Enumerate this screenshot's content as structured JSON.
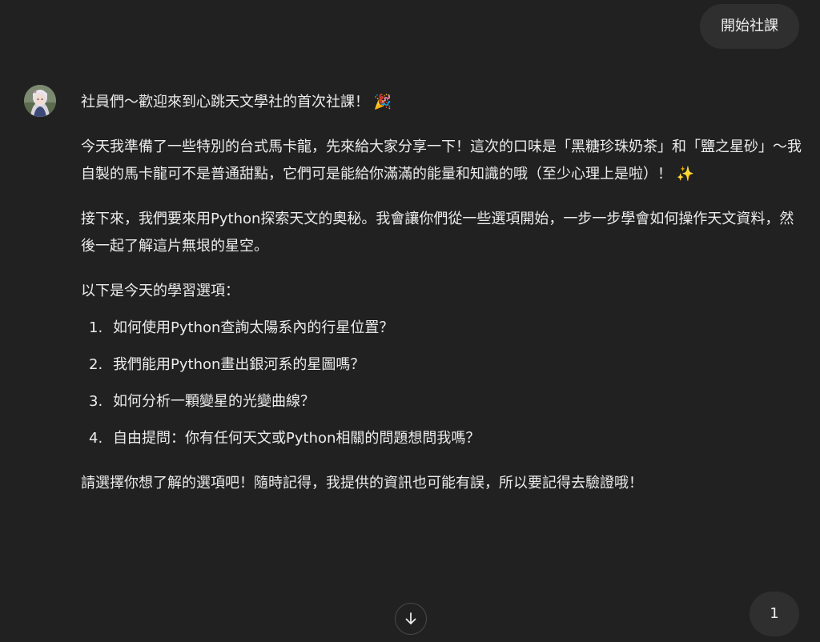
{
  "user_message": {
    "text": "開始社課"
  },
  "assistant": {
    "avatar_icon": "anime-girl-avatar-icon",
    "greeting": "社員們～歡迎來到心跳天文學社的首次社課！",
    "greeting_emoji": "🎉",
    "paragraph_macarons": "今天我準備了一些特別的台式馬卡龍，先來給大家分享一下！這次的口味是「黑糖珍珠奶茶」和「鹽之星砂」～我自製的馬卡龍可不是普通甜點，它們可是能給你滿滿的能量和知識的哦（至少心理上是啦）！",
    "paragraph_macarons_emoji": "✨",
    "paragraph_python": "接下來，我們要來用Python探索天文的奧秘。我會讓你們從一些選項開始，一步一步學會如何操作天文資料，然後一起了解這片無垠的星空。",
    "options_intro": "以下是今天的學習選項：",
    "options": [
      {
        "num": "1.",
        "text": "如何使用Python查詢太陽系內的行星位置？"
      },
      {
        "num": "2.",
        "text": "我們能用Python畫出銀河系的星圖嗎？"
      },
      {
        "num": "3.",
        "text": "如何分析一顆變星的光變曲線？"
      },
      {
        "num": "4.",
        "text": "自由提問：你有任何天文或Python相關的問題想問我嗎？"
      }
    ],
    "closing": "請選擇你想了解的選項吧！隨時記得，我提供的資訊也可能有誤，所以要記得去驗證哦！"
  },
  "scroll_button": {
    "icon": "arrow-down-icon"
  },
  "page_badge": {
    "label": "1"
  },
  "colors": {
    "background": "#212121",
    "bubble": "#2f2f2f",
    "text": "#ececec"
  }
}
